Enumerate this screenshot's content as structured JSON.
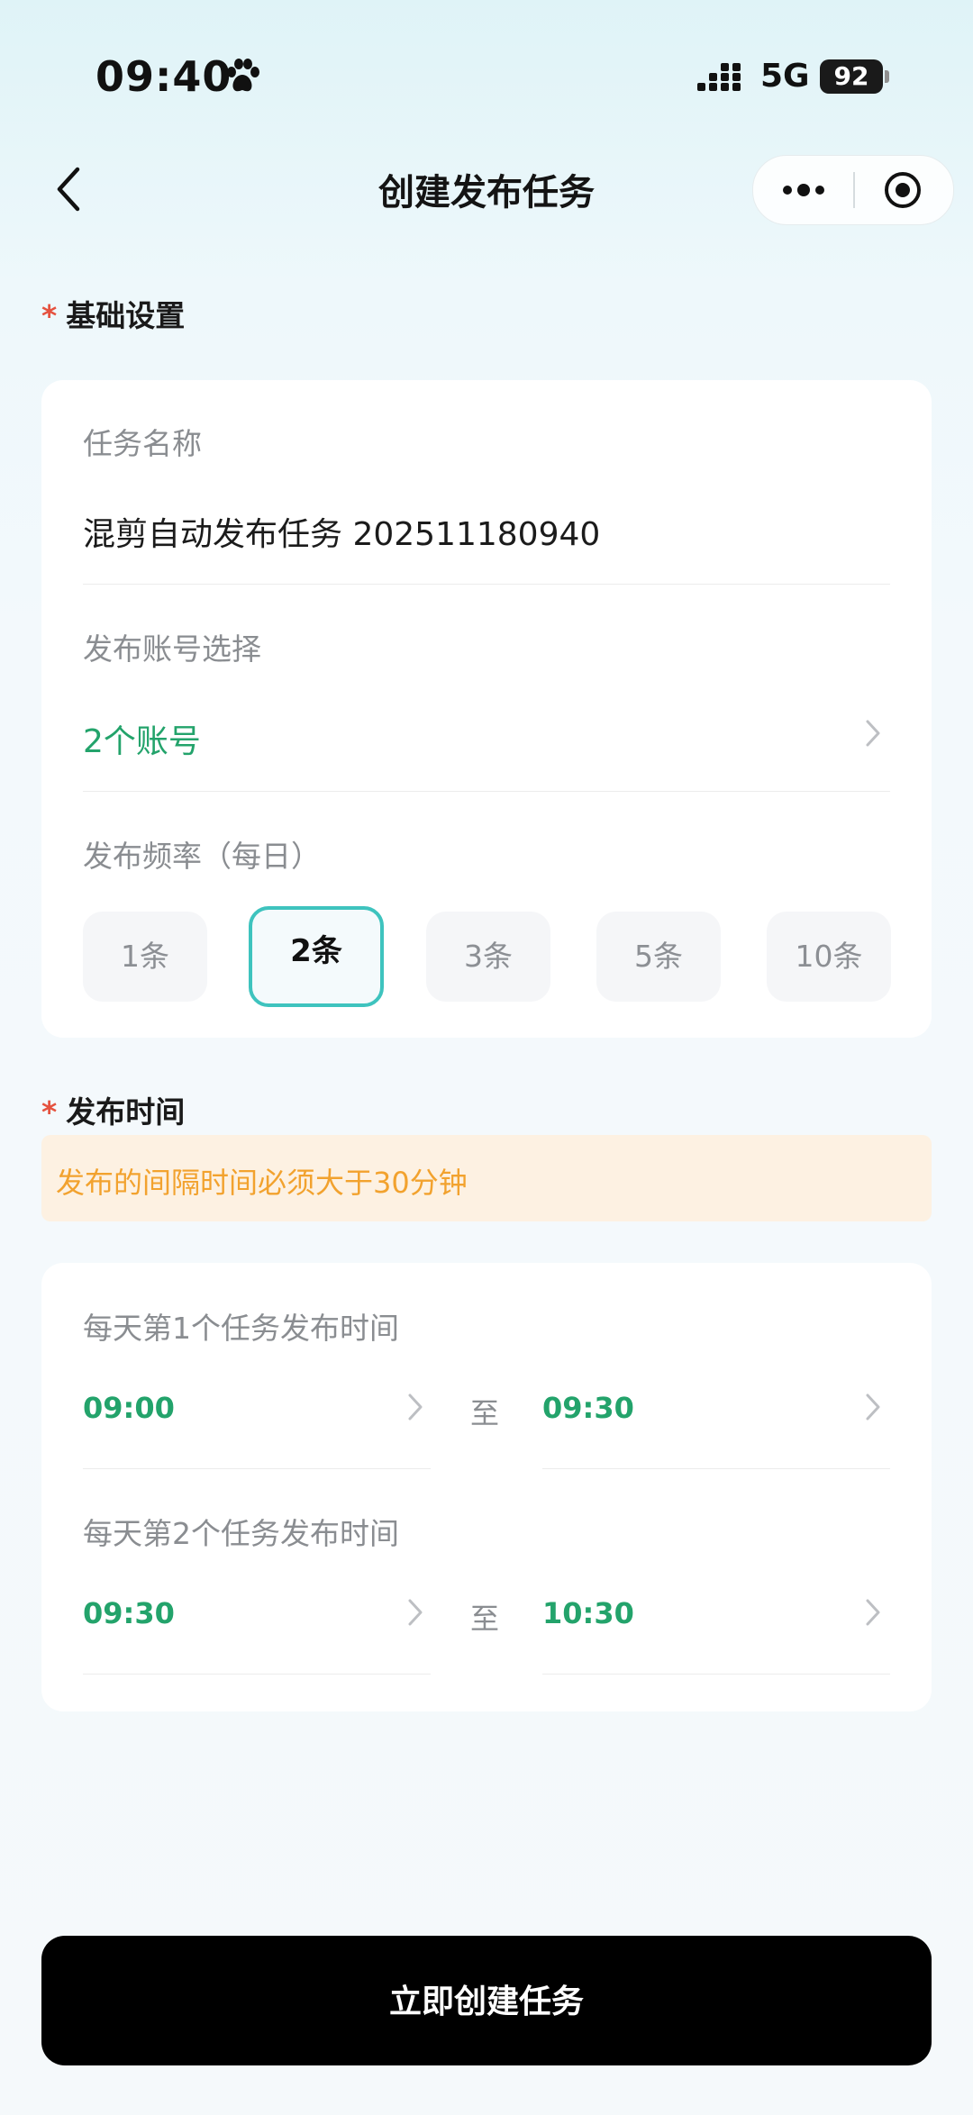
{
  "status_bar": {
    "time": "09:40",
    "network": "5G",
    "battery": "92"
  },
  "nav": {
    "title": "创建发布任务"
  },
  "basic_settings": {
    "required_mark": "*",
    "title": "基础设置",
    "task_name_label": "任务名称",
    "task_name_value": "混剪自动发布任务 202511180940",
    "account_label": "发布账号选择",
    "account_value": "2个账号",
    "frequency_label": "发布频率（每日）",
    "frequency_options": [
      "1条",
      "2条",
      "3条",
      "5条",
      "10条"
    ],
    "frequency_selected": "2条"
  },
  "publish_time": {
    "required_mark": "*",
    "title": "发布时间",
    "notice": "发布的间隔时间必须大于30分钟",
    "slots": [
      {
        "label": "每天第1个任务发布时间",
        "start": "09:00",
        "to": "至",
        "end": "09:30"
      },
      {
        "label": "每天第2个任务发布时间",
        "start": "09:30",
        "to": "至",
        "end": "10:30"
      }
    ]
  },
  "submit": {
    "label": "立即创建任务"
  },
  "colors": {
    "accent_green": "#23a36b",
    "selected_border": "#3ec3be",
    "required_red": "#e5523f",
    "notice_bg": "#fdf1e2",
    "notice_text": "#f2a22e"
  },
  "icons": {
    "status": "paw-icon",
    "signal": "signal-icon",
    "back": "chevron-left-icon",
    "more": "more-dots-icon",
    "close": "target-circle-icon",
    "row_arrow": "chevron-right-icon"
  }
}
